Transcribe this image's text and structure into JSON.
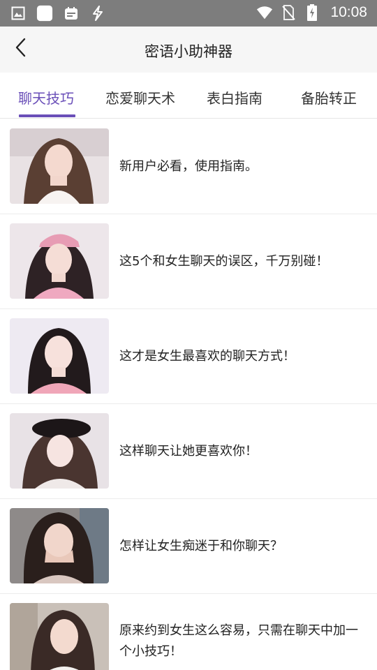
{
  "status_bar": {
    "time": "10:08",
    "left_icons": [
      "image-icon",
      "app-square-icon",
      "calendar-icon",
      "lightning-icon"
    ],
    "right_icons": [
      "wifi-icon",
      "no-sim-icon",
      "battery-icon"
    ]
  },
  "header": {
    "title": "密语小助神器",
    "back_icon": "chevron-left-icon"
  },
  "tabs": [
    {
      "label": "聊天技巧",
      "active": true
    },
    {
      "label": "恋爱聊天术",
      "active": false
    },
    {
      "label": "表白指南",
      "active": false
    },
    {
      "label": "备胎转正",
      "active": false
    }
  ],
  "articles": [
    {
      "title": "新用户必看，使用指南。"
    },
    {
      "title": "这5个和女生聊天的误区，千万别碰！"
    },
    {
      "title": "这才是女生最喜欢的聊天方式！"
    },
    {
      "title": "这样聊天让她更喜欢你！"
    },
    {
      "title": "怎样让女生痴迷于和你聊天？"
    },
    {
      "title": "原来约到女生这么容易，只需在聊天中加一个小技巧！"
    }
  ],
  "colors": {
    "accent": "#6a4fb8",
    "status_bar": "#7d7d7d",
    "header_bg": "#f6f6f6"
  }
}
